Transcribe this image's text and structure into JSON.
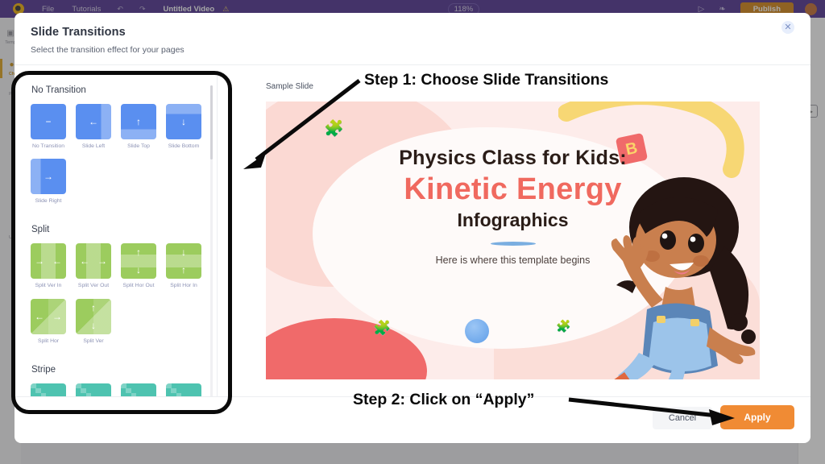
{
  "app": {
    "topbar": {
      "logo_icon": "app-logo-icon",
      "menu_file": "File",
      "menu_tutorials": "Tutorials",
      "undo_icon": "undo-icon",
      "redo_icon": "redo-icon",
      "doc_title": "Untitled Video",
      "doc_warning_icon": "warning-icon",
      "zoom_level": "118%",
      "present_icon": "play-icon",
      "share_icon": "share-icon",
      "publish_label": "Publish",
      "avatar_icon": "avatar"
    },
    "left_rail": [
      {
        "label": "Temp",
        "icon": "templates-icon",
        "active": false
      },
      {
        "label": "Ch",
        "icon": "charts-icon",
        "active": true
      },
      {
        "label": "P",
        "icon": "photos-icon",
        "active": false
      },
      {
        "label": "U",
        "icon": "uploads-icon",
        "active": false
      }
    ]
  },
  "modal": {
    "title": "Slide Transitions",
    "subtitle": "Select the transition effect for your pages",
    "close_icon": "close-icon",
    "footer": {
      "cancel_label": "Cancel",
      "apply_label": "Apply"
    }
  },
  "transitions": {
    "groups": [
      {
        "title": "No Transition",
        "color": "#5a8ff0",
        "items": [
          {
            "label": "No Transition",
            "glyph": "−",
            "style": "plain"
          },
          {
            "label": "Slide Left",
            "glyph": "←",
            "style": "edge-right"
          },
          {
            "label": "Slide Top",
            "glyph": "↑",
            "style": "edge-bottom"
          },
          {
            "label": "Slide Bottom",
            "glyph": "↓",
            "style": "edge-top"
          },
          {
            "label": "Slide Right",
            "glyph": "→",
            "style": "edge-left"
          }
        ]
      },
      {
        "title": "Split",
        "color": "#9ccc5e",
        "items": [
          {
            "label": "Split Ver In",
            "glyph": "→ ←",
            "style": "vbands"
          },
          {
            "label": "Split Ver Out",
            "glyph": "← →",
            "style": "vbands"
          },
          {
            "label": "Split Hor Out",
            "glyph": "↑ ↓",
            "style": "hbands"
          },
          {
            "label": "Split Hor In",
            "glyph": "↓ ↑",
            "style": "hbands"
          },
          {
            "label": "Split Hor",
            "glyph": "← →",
            "style": "quad-a"
          },
          {
            "label": "Split Ver",
            "glyph": "↑ ↓",
            "style": "quad-b"
          }
        ]
      },
      {
        "title": "Stripe",
        "color": "#4ec3b0",
        "items": [
          {
            "label": "",
            "glyph": "↑",
            "style": "stair"
          },
          {
            "label": "",
            "glyph": "↓",
            "style": "stair"
          },
          {
            "label": "",
            "glyph": "←",
            "style": "stair"
          },
          {
            "label": "",
            "glyph": "→",
            "style": "stair"
          }
        ]
      }
    ]
  },
  "preview": {
    "label": "Sample Slide",
    "slide": {
      "line1": "Physics Class for Kids:",
      "line2": "Kinetic Energy",
      "line3": "Infographics",
      "line4": "Here is where this template begins",
      "block_letter": "B",
      "illustration": "girl-illustration",
      "colors": {
        "background": "#fdecea",
        "accent_red": "#f0695f",
        "accent_yellow": "#f7d774",
        "accent_blue": "#5f9ee8",
        "text_dark": "#2b1d18"
      }
    }
  },
  "annotations": {
    "step1": "Step 1: Choose Slide Transitions",
    "step2": "Step 2: Click on “Apply”"
  }
}
